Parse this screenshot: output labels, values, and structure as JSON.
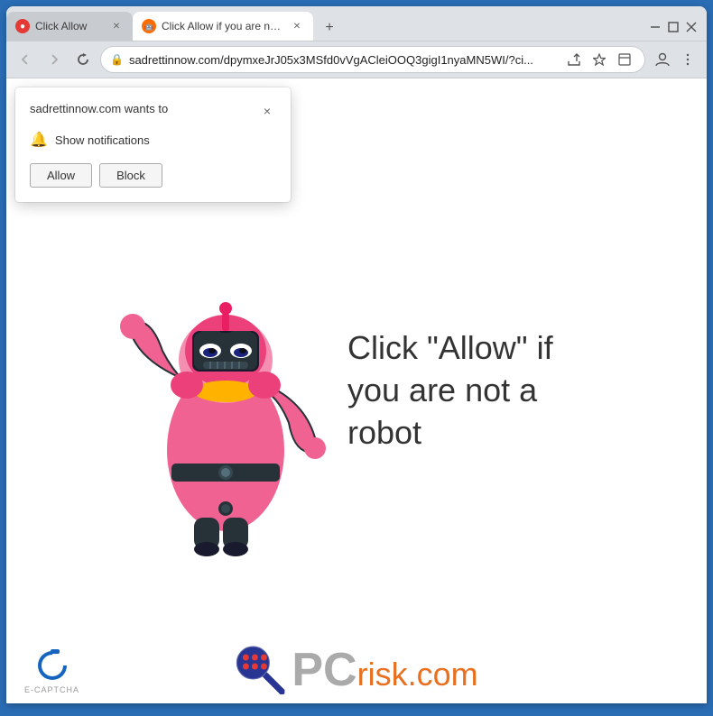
{
  "browser": {
    "tabs": [
      {
        "id": "tab1",
        "title": "Click Allow",
        "favicon": "red-dot",
        "active": false
      },
      {
        "id": "tab2",
        "title": "Click Allow if you are not a robot",
        "favicon": "orange-robot",
        "active": true
      }
    ],
    "address": "sadrettinnow.com/dpymxeJrJ05x3MSfd0vVgACleiOOQ3gigI1nyaMN5WI/?ci...",
    "new_tab_label": "+",
    "nav": {
      "back": "←",
      "forward": "→",
      "refresh": "↻"
    },
    "window_controls": {
      "minimize": "–",
      "maximize": "□",
      "close": "✕"
    }
  },
  "toolbar_icons": {
    "share": "⇧",
    "star": "☆",
    "extension": "□",
    "profile": "👤",
    "menu": "⋮"
  },
  "notification_popup": {
    "title": "sadrettinnow.com wants to",
    "permission": "Show notifications",
    "allow_label": "Allow",
    "block_label": "Block",
    "close_label": "×"
  },
  "page": {
    "main_text": "Click \"Allow\" if you are not a robot",
    "captcha_label": "E-CAPTCHA",
    "pcrisk_text": "PC",
    "pcrisk_suffix": "risk.com"
  },
  "colors": {
    "robot_body": "#f06292",
    "robot_dark": "#263238",
    "robot_accent": "#ffb300",
    "robot_eye": "#ffffff",
    "browser_border": "#2a6db5",
    "tab_active": "#ffffff",
    "tab_inactive": "#c8cbd0"
  }
}
